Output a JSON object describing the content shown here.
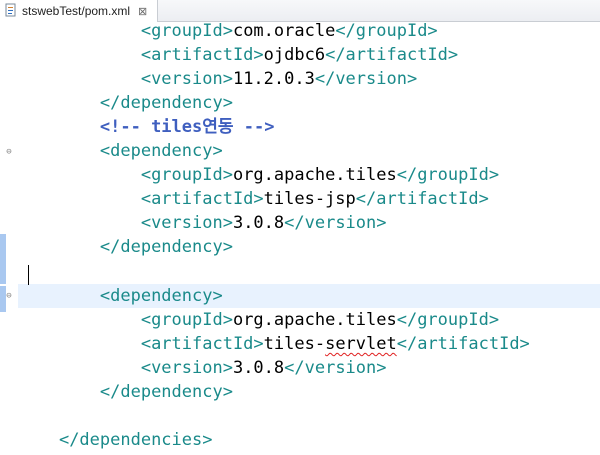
{
  "tab": {
    "title": "stswebTest/pom.xml",
    "close_symbol": "⊠"
  },
  "editor": {
    "lines": [
      {
        "indent": "            ",
        "open": "<groupId>",
        "value": "com.oracle",
        "close": "</groupId>"
      },
      {
        "indent": "            ",
        "open": "<artifactId>",
        "value": "ojdbc6",
        "close": "</artifactId>"
      },
      {
        "indent": "            ",
        "open": "<version>",
        "value": "11.2.0.3",
        "close": "</version>"
      },
      {
        "indent": "        ",
        "open": "</dependency>"
      },
      {
        "indent": "        ",
        "comment": "<!-- tiles연동 -->"
      },
      {
        "indent": "        ",
        "open": "<dependency>"
      },
      {
        "indent": "            ",
        "open": "<groupId>",
        "value": "org.apache.tiles",
        "close": "</groupId>"
      },
      {
        "indent": "            ",
        "open": "<artifactId>",
        "value": "tiles-jsp",
        "close": "</artifactId>"
      },
      {
        "indent": "            ",
        "open": "<version>",
        "value": "3.0.8",
        "close": "</version>"
      },
      {
        "indent": "        ",
        "open": "</dependency>"
      },
      {
        "indent": ""
      },
      {
        "indent": "        ",
        "open": "<dependency>"
      },
      {
        "indent": "            ",
        "open": "<groupId>",
        "value": "org.apache.tiles",
        "close": "</groupId>"
      },
      {
        "indent": "            ",
        "open": "<artifactId>",
        "value_a": "tiles-",
        "value_b": "servlet",
        "close": "</artifactId>"
      },
      {
        "indent": "            ",
        "open": "<version>",
        "value": "3.0.8",
        "close": "</version>"
      },
      {
        "indent": "        ",
        "open": "</dependency>"
      },
      {
        "indent": ""
      },
      {
        "indent": "    ",
        "open": "</dependencies>"
      }
    ]
  },
  "colors": {
    "tag": "#1a8a8a",
    "comment": "#3f5fbf",
    "current_line": "#e8f2fe",
    "change_mark": "#a9c8f0"
  }
}
